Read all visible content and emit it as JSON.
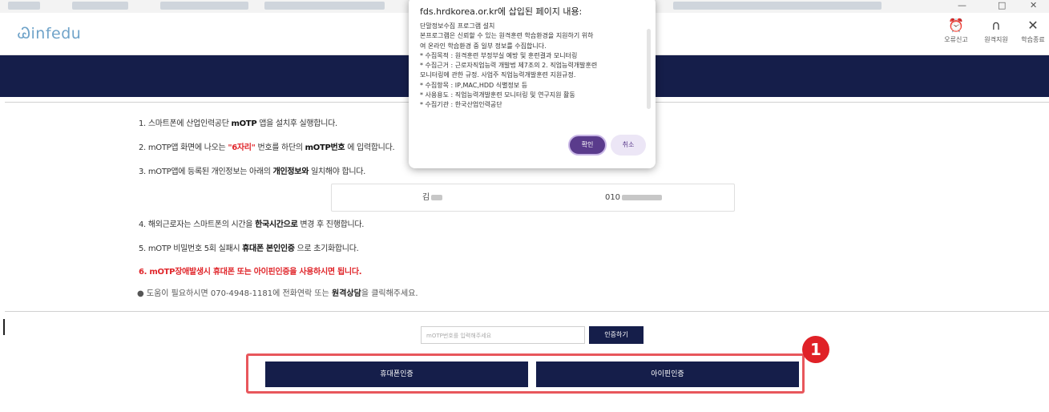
{
  "browser": {
    "window_controls": [
      "—",
      "□",
      "✕"
    ]
  },
  "header": {
    "logo": "Ꮚinfedu",
    "icons": [
      {
        "name": "alarm-icon",
        "glyph": "⏰",
        "label": "오류신고"
      },
      {
        "name": "headset-icon",
        "glyph": "∩",
        "label": "원격지원"
      },
      {
        "name": "close-icon",
        "glyph": "✕",
        "label": "학습종료"
      }
    ]
  },
  "steps": {
    "s1": {
      "pre": "1. 스마트폰에 산업인력공단 ",
      "bold": "mOTP",
      "post": " 앱을 설치후 실행합니다."
    },
    "s2": {
      "pre": "2. mOTP앱 화면에 나오는 ",
      "red": "\"6자리\"",
      "mid": " 번호를 하단의 ",
      "bold": "mOTP번호",
      "post": " 에 입력합니다."
    },
    "s3": {
      "pre": "3. mOTP앱에 등록된 개인정보는 아래의 ",
      "bold": "개인정보와",
      "post": " 일치해야 합니다."
    },
    "s4": {
      "pre": "4. 해외근로자는 스마트폰의 시간을 ",
      "bold": "한국시간으로",
      "post": " 변경 후 진행합니다."
    },
    "s5": {
      "pre": "5. mOTP 비밀번호 5회 실패시 ",
      "bold": "휴대폰 본인인증",
      "post": " 으로 초기화합니다."
    },
    "s6": "6. mOTP장애발생시 휴대폰 또는 아이핀인증을 사용하시면 됩니다."
  },
  "info": {
    "name": "김",
    "phone": "010"
  },
  "help": {
    "pre": "● 도움이 필요하시면 070-4948-1181에 전화연락 또는 ",
    "bold": "원격상담",
    "post": "을 클릭해주세요."
  },
  "otp": {
    "placeholder": "mOTP번호를 입력해주세요",
    "button": "인증하기"
  },
  "auth": {
    "phone_button": "휴대폰인증",
    "ipin_button": "아이핀인증"
  },
  "annotation": {
    "badge": "1"
  },
  "dialog": {
    "title": "fds.hrdkorea.or.kr에 삽입된 페이지 내용:",
    "lines": [
      "단말정보수집 프로그램 설치",
      "본프로그램은 신뢰할 수 있는 원격훈련 학습환경을 지원하기 위하",
      "여 온라인 학습환경 중 일부 정보를 수집합니다.",
      "* 수집목적 : 원격훈련 부정부실 예방 및 훈련결과 모니터링",
      "* 수집근거 : 근로자직업능력 개발법 제7조의 2. 직업능력개발훈련",
      "모니터링에 관한 규정. 사업주 직업능력개발훈련 지원규정.",
      "* 수집항목 : IP,MAC,HDD 식별정보 등",
      "* 사용용도 : 직업능력개발훈련 모니터링 및 연구지원 활동",
      "* 수집기관 : 한국산업인력공단"
    ],
    "ok": "확인",
    "cancel": "취소"
  },
  "colors": {
    "navy": "#151e4a",
    "accent_red": "#e0262b",
    "highlight": "#e8575c",
    "dialog_purple": "#5a3b8c"
  }
}
